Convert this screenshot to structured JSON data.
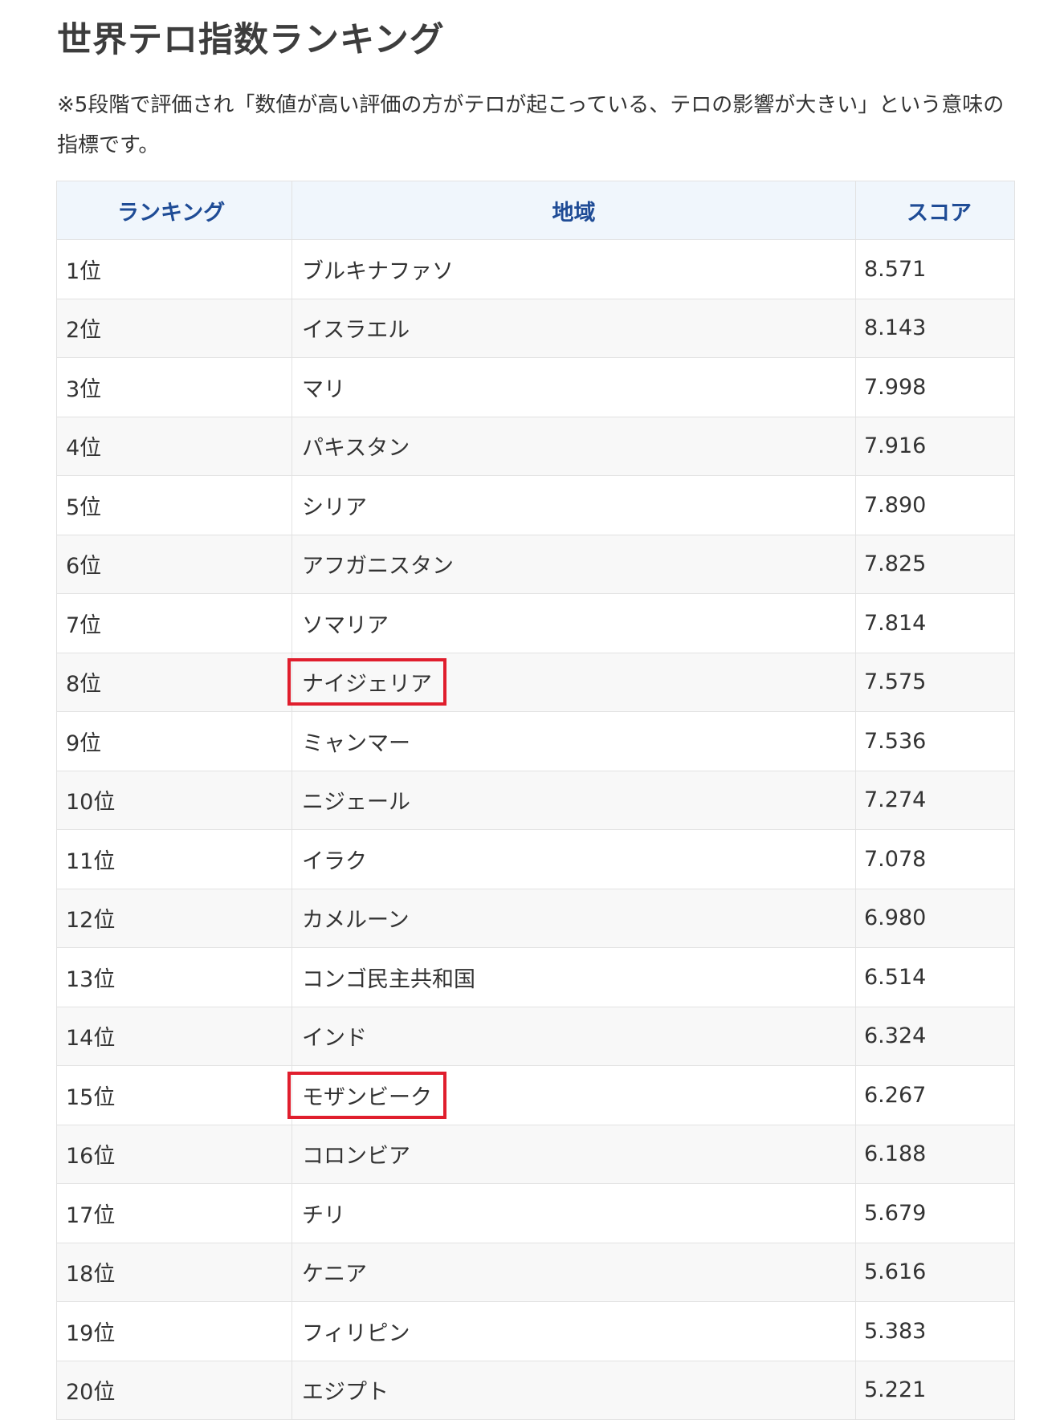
{
  "page": {
    "title": "世界テロ指数ランキング",
    "note": "※5段階で評価され「数値が高い評価の方がテロが起こっている、テロの影響が大きい」という意味の指標です。"
  },
  "table": {
    "headers": [
      "ランキング",
      "地域",
      "スコア"
    ],
    "rows": [
      {
        "rank": "1位",
        "region": "ブルキナファソ",
        "score": "8.571",
        "highlight": false
      },
      {
        "rank": "2位",
        "region": "イスラエル",
        "score": "8.143",
        "highlight": false
      },
      {
        "rank": "3位",
        "region": "マリ",
        "score": "7.998",
        "highlight": false
      },
      {
        "rank": "4位",
        "region": "パキスタン",
        "score": "7.916",
        "highlight": false
      },
      {
        "rank": "5位",
        "region": "シリア",
        "score": "7.890",
        "highlight": false
      },
      {
        "rank": "6位",
        "region": "アフガニスタン",
        "score": "7.825",
        "highlight": false
      },
      {
        "rank": "7位",
        "region": "ソマリア",
        "score": "7.814",
        "highlight": false
      },
      {
        "rank": "8位",
        "region": "ナイジェリア",
        "score": "7.575",
        "highlight": true
      },
      {
        "rank": "9位",
        "region": "ミャンマー",
        "score": "7.536",
        "highlight": false
      },
      {
        "rank": "10位",
        "region": "ニジェール",
        "score": "7.274",
        "highlight": false
      },
      {
        "rank": "11位",
        "region": "イラク",
        "score": "7.078",
        "highlight": false
      },
      {
        "rank": "12位",
        "region": "カメルーン",
        "score": "6.980",
        "highlight": false
      },
      {
        "rank": "13位",
        "region": "コンゴ民主共和国",
        "score": "6.514",
        "highlight": false
      },
      {
        "rank": "14位",
        "region": "インド",
        "score": "6.324",
        "highlight": false
      },
      {
        "rank": "15位",
        "region": "モザンビーク",
        "score": "6.267",
        "highlight": true
      },
      {
        "rank": "16位",
        "region": "コロンビア",
        "score": "6.188",
        "highlight": false
      },
      {
        "rank": "17位",
        "region": "チリ",
        "score": "5.679",
        "highlight": false
      },
      {
        "rank": "18位",
        "region": "ケニア",
        "score": "5.616",
        "highlight": false
      },
      {
        "rank": "19位",
        "region": "フィリピン",
        "score": "5.383",
        "highlight": false
      },
      {
        "rank": "20位",
        "region": "エジプト",
        "score": "5.221",
        "highlight": false
      }
    ]
  },
  "colors": {
    "header_text": "#1f4c96",
    "header_bg": "#f0f6fc",
    "highlight_border": "#e01e2d"
  }
}
